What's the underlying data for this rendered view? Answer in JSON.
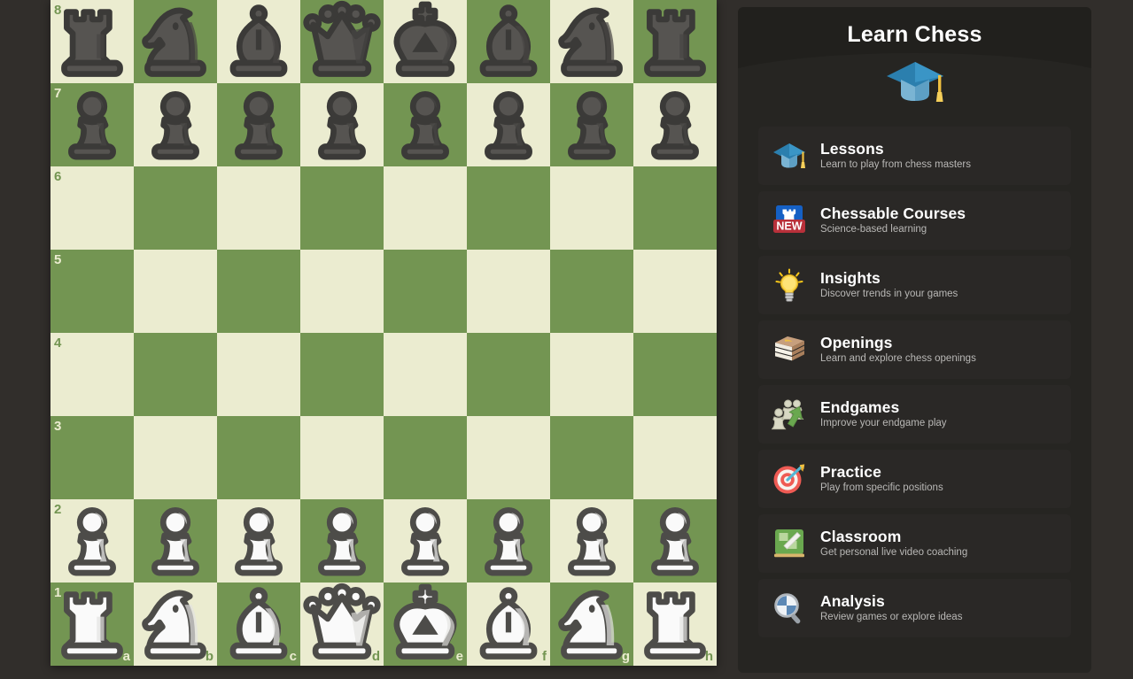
{
  "board": {
    "light_square_color": "#ebecd0",
    "dark_square_color": "#739552",
    "orientation": "white",
    "files": [
      "a",
      "b",
      "c",
      "d",
      "e",
      "f",
      "g",
      "h"
    ],
    "ranks": [
      "8",
      "7",
      "6",
      "5",
      "4",
      "3",
      "2",
      "1"
    ],
    "position_name": "starting position",
    "rows": [
      [
        {
          "square": "a8",
          "piece": "rook",
          "color": "black"
        },
        {
          "square": "b8",
          "piece": "knight",
          "color": "black"
        },
        {
          "square": "c8",
          "piece": "bishop",
          "color": "black"
        },
        {
          "square": "d8",
          "piece": "queen",
          "color": "black"
        },
        {
          "square": "e8",
          "piece": "king",
          "color": "black"
        },
        {
          "square": "f8",
          "piece": "bishop",
          "color": "black"
        },
        {
          "square": "g8",
          "piece": "knight",
          "color": "black"
        },
        {
          "square": "h8",
          "piece": "rook",
          "color": "black"
        }
      ],
      [
        {
          "square": "a7",
          "piece": "pawn",
          "color": "black"
        },
        {
          "square": "b7",
          "piece": "pawn",
          "color": "black"
        },
        {
          "square": "c7",
          "piece": "pawn",
          "color": "black"
        },
        {
          "square": "d7",
          "piece": "pawn",
          "color": "black"
        },
        {
          "square": "e7",
          "piece": "pawn",
          "color": "black"
        },
        {
          "square": "f7",
          "piece": "pawn",
          "color": "black"
        },
        {
          "square": "g7",
          "piece": "pawn",
          "color": "black"
        },
        {
          "square": "h7",
          "piece": "pawn",
          "color": "black"
        }
      ],
      [
        {
          "square": "a6",
          "piece": null
        },
        {
          "square": "b6",
          "piece": null
        },
        {
          "square": "c6",
          "piece": null
        },
        {
          "square": "d6",
          "piece": null
        },
        {
          "square": "e6",
          "piece": null
        },
        {
          "square": "f6",
          "piece": null
        },
        {
          "square": "g6",
          "piece": null
        },
        {
          "square": "h6",
          "piece": null
        }
      ],
      [
        {
          "square": "a5",
          "piece": null
        },
        {
          "square": "b5",
          "piece": null
        },
        {
          "square": "c5",
          "piece": null
        },
        {
          "square": "d5",
          "piece": null
        },
        {
          "square": "e5",
          "piece": null
        },
        {
          "square": "f5",
          "piece": null
        },
        {
          "square": "g5",
          "piece": null
        },
        {
          "square": "h5",
          "piece": null
        }
      ],
      [
        {
          "square": "a4",
          "piece": null
        },
        {
          "square": "b4",
          "piece": null
        },
        {
          "square": "c4",
          "piece": null
        },
        {
          "square": "d4",
          "piece": null
        },
        {
          "square": "e4",
          "piece": null
        },
        {
          "square": "f4",
          "piece": null
        },
        {
          "square": "g4",
          "piece": null
        },
        {
          "square": "h4",
          "piece": null
        }
      ],
      [
        {
          "square": "a3",
          "piece": null
        },
        {
          "square": "b3",
          "piece": null
        },
        {
          "square": "c3",
          "piece": null
        },
        {
          "square": "d3",
          "piece": null
        },
        {
          "square": "e3",
          "piece": null
        },
        {
          "square": "f3",
          "piece": null
        },
        {
          "square": "g3",
          "piece": null
        },
        {
          "square": "h3",
          "piece": null
        }
      ],
      [
        {
          "square": "a2",
          "piece": "pawn",
          "color": "white"
        },
        {
          "square": "b2",
          "piece": "pawn",
          "color": "white"
        },
        {
          "square": "c2",
          "piece": "pawn",
          "color": "white"
        },
        {
          "square": "d2",
          "piece": "pawn",
          "color": "white"
        },
        {
          "square": "e2",
          "piece": "pawn",
          "color": "white"
        },
        {
          "square": "f2",
          "piece": "pawn",
          "color": "white"
        },
        {
          "square": "g2",
          "piece": "pawn",
          "color": "white"
        },
        {
          "square": "h2",
          "piece": "pawn",
          "color": "white"
        }
      ],
      [
        {
          "square": "a1",
          "piece": "rook",
          "color": "white"
        },
        {
          "square": "b1",
          "piece": "knight",
          "color": "white"
        },
        {
          "square": "c1",
          "piece": "bishop",
          "color": "white"
        },
        {
          "square": "d1",
          "piece": "queen",
          "color": "white"
        },
        {
          "square": "e1",
          "piece": "king",
          "color": "white"
        },
        {
          "square": "f1",
          "piece": "bishop",
          "color": "white"
        },
        {
          "square": "g1",
          "piece": "knight",
          "color": "white"
        },
        {
          "square": "h1",
          "piece": "rook",
          "color": "white"
        }
      ]
    ]
  },
  "panel": {
    "title": "Learn Chess",
    "logo_icon": "graduation-cap-icon",
    "background_color": "#262522",
    "items": [
      {
        "icon": "graduation-cap-icon",
        "title": "Lessons",
        "subtitle": "Learn to play from chess masters"
      },
      {
        "icon": "chessable-new-badge-icon",
        "title": "Chessable Courses",
        "subtitle": "Science-based learning",
        "badge": "NEW"
      },
      {
        "icon": "lightbulb-icon",
        "title": "Insights",
        "subtitle": "Discover trends in your games"
      },
      {
        "icon": "books-stack-icon",
        "title": "Openings",
        "subtitle": "Learn and explore chess openings"
      },
      {
        "icon": "pieces-arrow-icon",
        "title": "Endgames",
        "subtitle": "Improve your endgame play"
      },
      {
        "icon": "target-dart-icon",
        "title": "Practice",
        "subtitle": "Play from specific positions"
      },
      {
        "icon": "chalkboard-icon",
        "title": "Classroom",
        "subtitle": "Get personal live video coaching"
      },
      {
        "icon": "magnifier-icon",
        "title": "Analysis",
        "subtitle": "Review games or explore ideas"
      }
    ]
  }
}
